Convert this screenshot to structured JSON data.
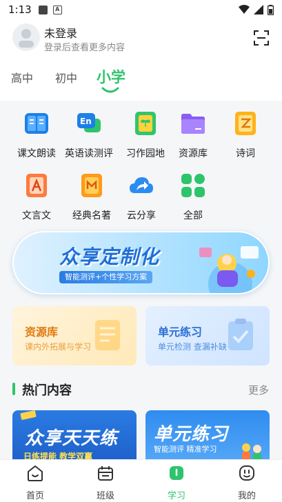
{
  "status": {
    "time": "1:13"
  },
  "user": {
    "title": "未登录",
    "subtitle": "登录后查看更多内容"
  },
  "tabs": [
    {
      "label": "高中",
      "active": false
    },
    {
      "label": "初中",
      "active": false
    },
    {
      "label": "小学",
      "active": true
    }
  ],
  "grid": [
    {
      "label": "课文朗读",
      "icon": "book-read-icon"
    },
    {
      "label": "英语读测评",
      "icon": "english-eval-icon"
    },
    {
      "label": "习作园地",
      "icon": "writing-icon"
    },
    {
      "label": "资源库",
      "icon": "folder-icon"
    },
    {
      "label": "诗词",
      "icon": "poetry-icon"
    },
    {
      "label": "文言文",
      "icon": "classical-chinese-icon"
    },
    {
      "label": "经典名著",
      "icon": "classics-icon"
    },
    {
      "label": "云分享",
      "icon": "cloud-share-icon"
    },
    {
      "label": "全部",
      "icon": "all-apps-icon"
    }
  ],
  "banner": {
    "title": "众享定制化",
    "subtitle": "智能测评+个性学习方案"
  },
  "cards": [
    {
      "title": "资源库",
      "subtitle": "课内外拓展与学习"
    },
    {
      "title": "单元练习",
      "subtitle": "单元检测  查漏补缺"
    }
  ],
  "section": {
    "title": "热门内容",
    "more": "更多"
  },
  "hot": [
    {
      "title": "众享天天练",
      "subtitle": "日练提能  教学双赢"
    },
    {
      "title": "单元练习",
      "subtitle": "智能测评  精准学习"
    }
  ],
  "nav": [
    {
      "label": "首页",
      "icon": "home-icon",
      "active": false
    },
    {
      "label": "班级",
      "icon": "class-icon",
      "active": false
    },
    {
      "label": "学习",
      "icon": "study-icon",
      "active": true
    },
    {
      "label": "我的",
      "icon": "profile-icon",
      "active": false
    }
  ],
  "colors": {
    "accent": "#2ec46b"
  }
}
